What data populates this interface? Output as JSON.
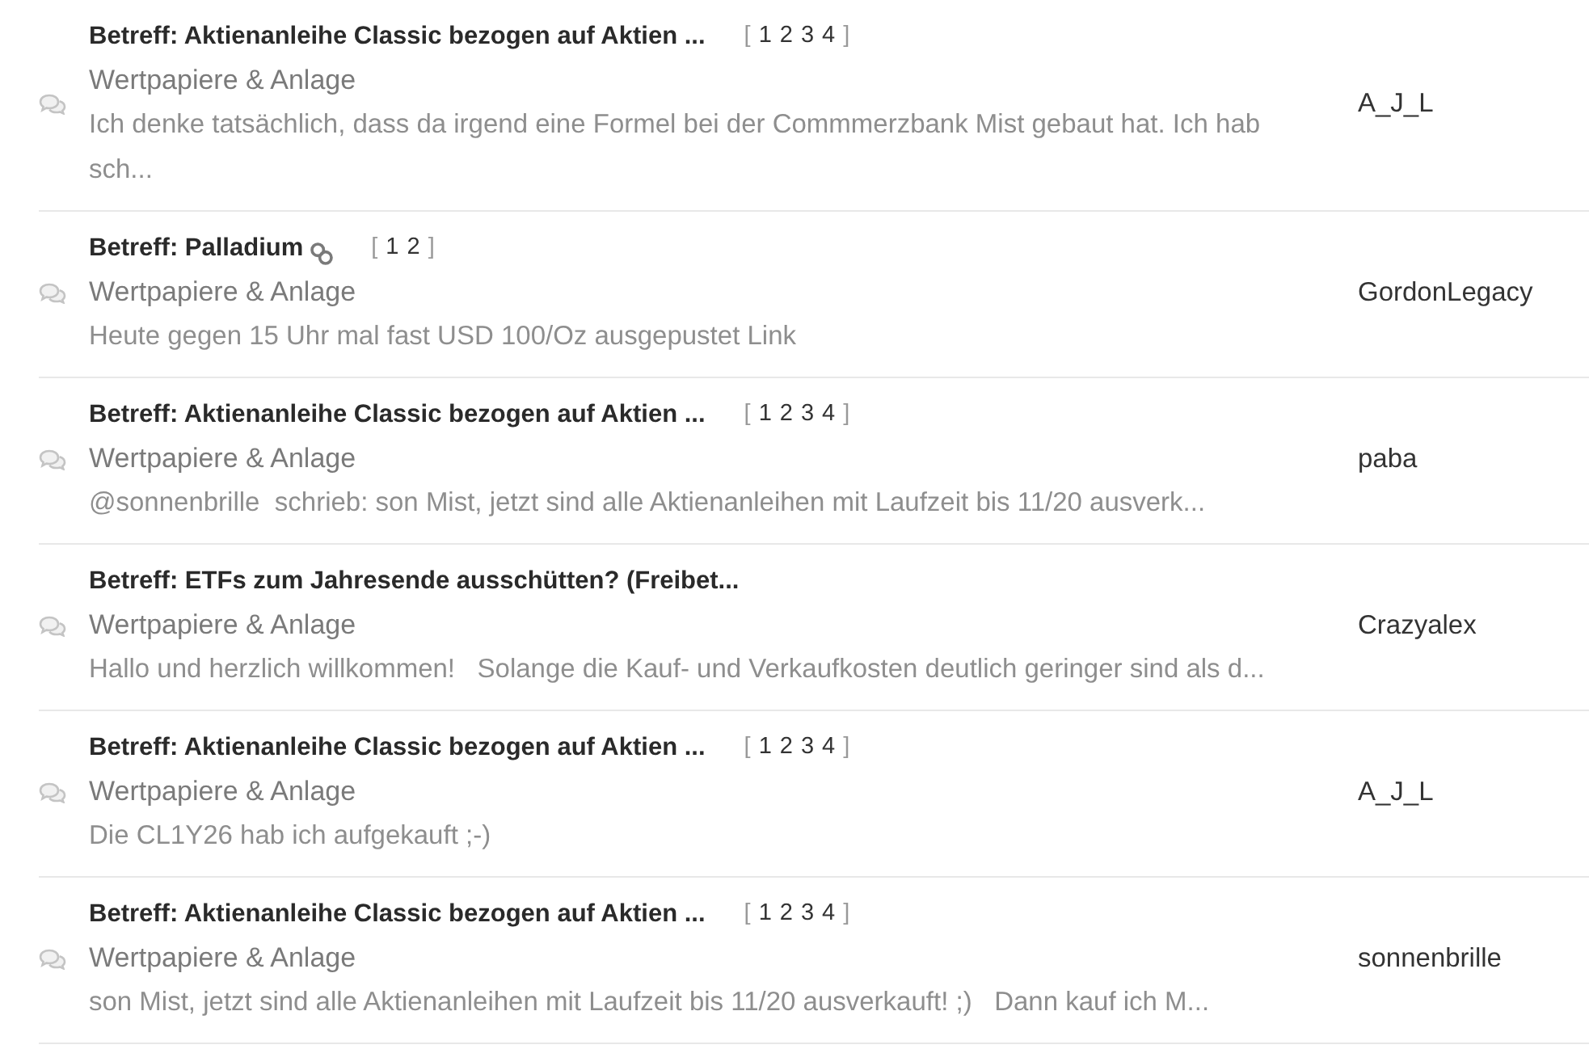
{
  "threads": [
    {
      "title": "Betreff: Aktienanleihe Classic bezogen auf Aktien ...",
      "linked": false,
      "pages": {
        "open": "[",
        "links": [
          "1",
          "2",
          "3",
          "4"
        ],
        "close": "]"
      },
      "forum": "Wertpapiere & Anlage",
      "excerpt": "Ich denke tatsächlich, dass da irgend eine Formel bei der Commmerzbank Mist gebaut hat. Ich hab sch...",
      "author": "A_J_L"
    },
    {
      "title": "Betreff: Palladium",
      "linked": true,
      "pages": {
        "open": "[",
        "links": [
          "1",
          "2"
        ],
        "close": "]"
      },
      "forum": "Wertpapiere & Anlage",
      "excerpt": "Heute gegen 15 Uhr mal fast USD 100/Oz ausgepustet Link",
      "author": "GordonLegacy"
    },
    {
      "title": "Betreff: Aktienanleihe Classic bezogen auf Aktien ...",
      "linked": false,
      "pages": {
        "open": "[",
        "links": [
          "1",
          "2",
          "3",
          "4"
        ],
        "close": "]"
      },
      "forum": "Wertpapiere & Anlage",
      "excerpt": "@sonnenbrille  schrieb: son Mist, jetzt sind alle Aktienanleihen mit Laufzeit bis 11/20 ausverk...",
      "author": "paba"
    },
    {
      "title": "Betreff: ETFs zum Jahresende ausschütten? (Freibet...",
      "linked": false,
      "forum": "Wertpapiere & Anlage",
      "excerpt": "Hallo und herzlich willkommen!   Solange die Kauf- und Verkaufkosten deutlich geringer sind als d...",
      "author": "Crazyalex"
    },
    {
      "title": "Betreff: Aktienanleihe Classic bezogen auf Aktien ...",
      "linked": false,
      "pages": {
        "open": "[",
        "links": [
          "1",
          "2",
          "3",
          "4"
        ],
        "close": "]"
      },
      "forum": "Wertpapiere & Anlage",
      "excerpt": "Die CL1Y26 hab ich aufgekauft ;-)",
      "author": "A_J_L"
    },
    {
      "title": "Betreff: Aktienanleihe Classic bezogen auf Aktien ...",
      "linked": false,
      "pages": {
        "open": "[",
        "links": [
          "1",
          "2",
          "3",
          "4"
        ],
        "close": "]"
      },
      "forum": "Wertpapiere & Anlage",
      "excerpt": "son Mist, jetzt sind alle Aktienanleihen mit Laufzeit bis 11/20 ausverkauft! ;)   Dann kauf ich M...",
      "author": "sonnenbrille"
    }
  ]
}
